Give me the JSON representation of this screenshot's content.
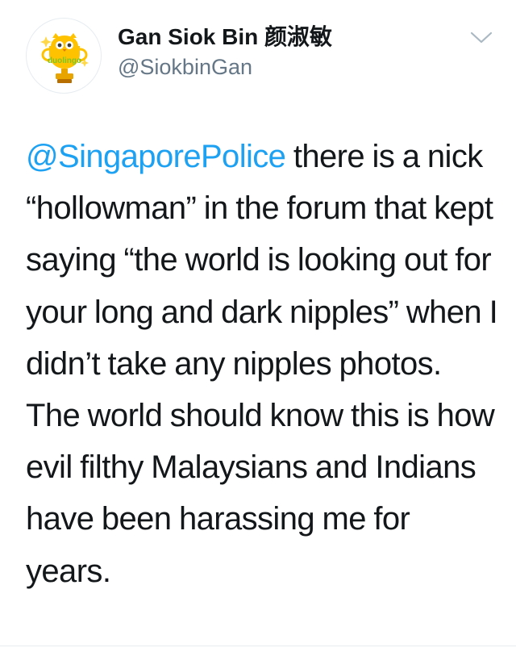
{
  "tweet": {
    "author": {
      "display_name": "Gan Siok Bin 颜淑敏",
      "handle": "@SiokbinGan",
      "avatar_text": "duolingo"
    },
    "mention": "@SingaporePolice",
    "text": " there is a nick “hollowman” in the forum that kept saying “the world is looking out for your long and dark nipples” when I didn’t take any nipples photos. The world should know this is how evil filthy Malaysians and Indians have been harassing me for years."
  },
  "icons": {
    "avatar": "duolingo-owl-trophy-icon",
    "menu": "chevron-down-icon"
  },
  "colors": {
    "mention": "#1da1f2",
    "text": "#14171a",
    "handle": "#657786",
    "owl_green": "#7cc623",
    "trophy_gold": "#e8a400"
  }
}
